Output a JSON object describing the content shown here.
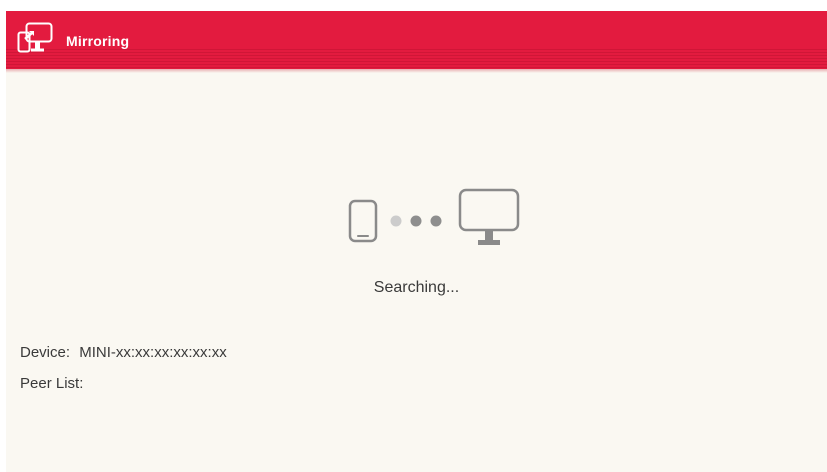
{
  "header": {
    "title": "Mirroring",
    "icon": "screen-mirroring-icon",
    "background_color": "#e31b3f"
  },
  "main": {
    "status_text": "Searching...",
    "graphic": {
      "left_icon": "smartphone-icon",
      "right_icon": "monitor-icon",
      "dots": [
        "progress-dot",
        "progress-dot",
        "progress-dot"
      ]
    }
  },
  "info": {
    "device_label": "Device:",
    "device_value": "MINI-xx:xx:xx:xx:xx:xx",
    "peer_list_label": "Peer List:"
  }
}
